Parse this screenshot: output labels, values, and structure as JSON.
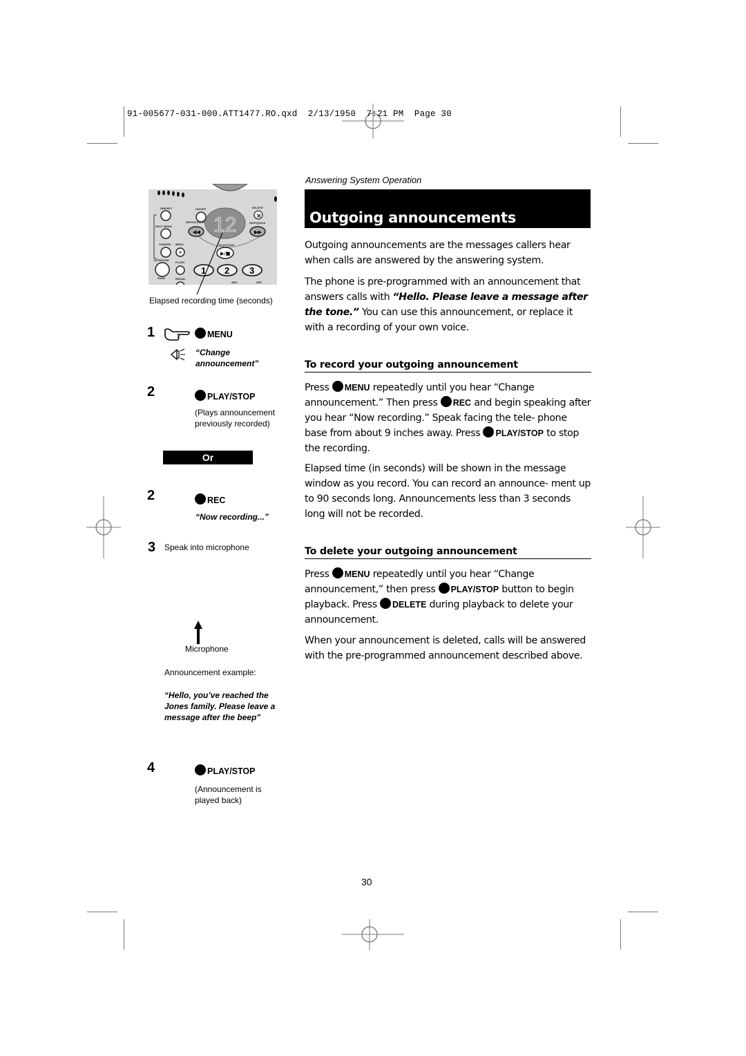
{
  "slug": "91-005677-031-000.ATT1477.RO.qxd  2/13/1950  7:21 PM  Page 30",
  "header": {
    "section": "Answering System Operation",
    "title": "Outgoing announcements"
  },
  "phone_illustration": {
    "display_value": "12",
    "button_labels": [
      "TIME/SET",
      "ON/OFF",
      "DELETE",
      "DECT MENU",
      "REPEAT/SLOW",
      "SKIP/QUICK",
      "CHARGE",
      "MENU",
      "PLAY/STOP",
      "INTERCOM",
      "FLASH",
      "PAGE",
      "REDIAL",
      "1",
      "2",
      "3",
      "ABC",
      "DEF"
    ],
    "caption": "Elapsed recording time (seconds)"
  },
  "steps": {
    "s1": {
      "num": "1",
      "button": "MENU",
      "voice": "“Change announcement”",
      "voice_line1": "“Change",
      "voice_line2": "announcement”"
    },
    "s2a": {
      "num": "2",
      "button": "PLAY/STOP",
      "note_line1": "(Plays announcement",
      "note_line2": "previously recorded)"
    },
    "or_label": "Or",
    "s2b": {
      "num": "2",
      "button": "REC",
      "voice": "“Now recording...”"
    },
    "s3": {
      "num": "3",
      "text": "Speak into microphone"
    },
    "microphone_label": "Microphone",
    "example_label": "Announcement example:",
    "example_line1": "“Hello, you’ve reached the",
    "example_line2": "Jones family. Please leave a",
    "example_line3": "message after the beep\"",
    "s4": {
      "num": "4",
      "button": "PLAY/STOP",
      "note_line1": "(Announcement is",
      "note_line2": "played back)"
    }
  },
  "content": {
    "intro": "Outgoing announcements are the messages callers hear when calls are answered by the answering system.",
    "preprog_a": "The phone is pre-programmed with an announcement that answers calls with ",
    "preprog_quote": "“Hello. Please leave a message after the tone.”",
    "preprog_b": " You can use this announcement, or replace it with a recording of your own voice.",
    "record_heading": "To record your outgoing announcement",
    "record": {
      "t1": "Press ",
      "k1": "MENU",
      "t2": " repeatedly until you hear “Change announcement.” Then press ",
      "k2": "REC",
      "t3": " and begin speaking after you hear “Now recording.” Speak facing the tele- phone base from about 9 inches away. Press ",
      "k3": "PLAY/STOP",
      "t4": " to stop the recording."
    },
    "elapsed": "Elapsed time (in seconds) will be shown in the message window as you record. You can record an announce- ment up to 90 seconds long. Announcements less than 3 seconds long will not be recorded.",
    "delete_heading": "To delete your outgoing announcement",
    "delete": {
      "t1": "Press ",
      "k1": "MENU",
      "t2": " repeatedly until you hear “Change announcement,” then press ",
      "k2": "PLAY/STOP",
      "t3": " button to begin playback. Press ",
      "k3": "DELETE",
      "t4": " during playback to delete your announcement."
    },
    "after_delete": "When your announcement is deleted, calls will be answered with the pre-programmed announcement described above."
  },
  "page_number": "30"
}
